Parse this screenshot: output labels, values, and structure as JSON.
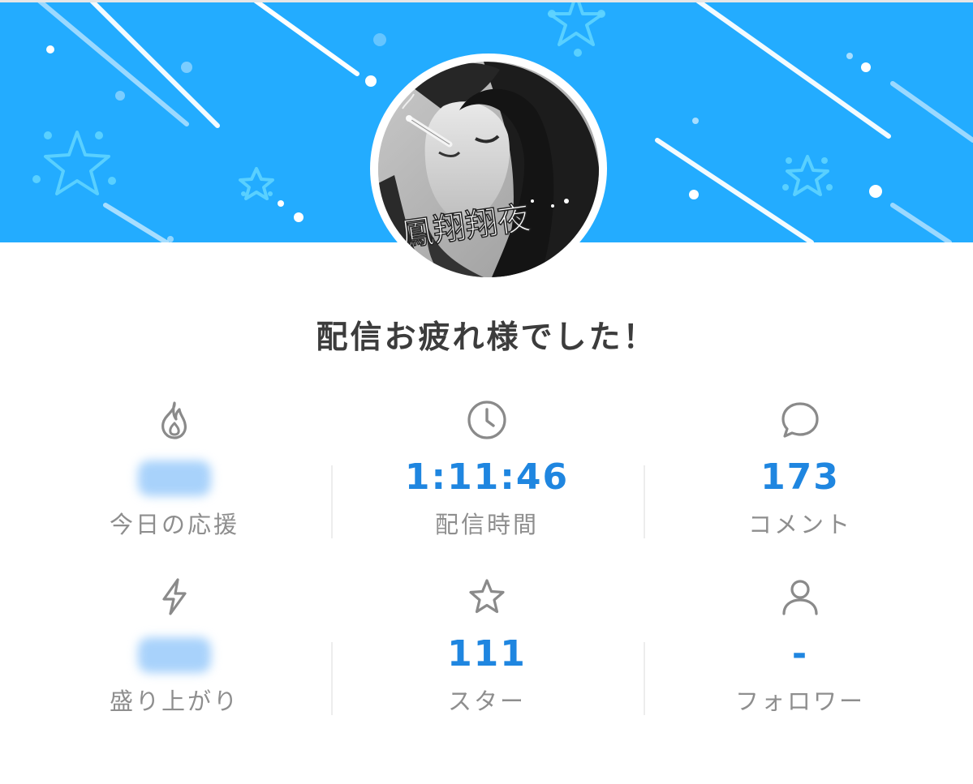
{
  "banner": {
    "color": "#23acff"
  },
  "avatar": {
    "signature_text": "鳳翔翔夜"
  },
  "title": "配信お疲れ様でした！",
  "stats": [
    {
      "icon": "flame-icon",
      "value": "",
      "label": "今日の応援",
      "value_hidden": true
    },
    {
      "icon": "clock-icon",
      "value": "1:11:46",
      "label": "配信時間"
    },
    {
      "icon": "comment-icon",
      "value": "173",
      "label": "コメント"
    },
    {
      "icon": "lightning-icon",
      "value": "",
      "label": "盛り上がり",
      "value_hidden": true
    },
    {
      "icon": "star-icon",
      "value": "111",
      "label": "スター"
    },
    {
      "icon": "person-icon",
      "value": "-",
      "label": "フォロワー"
    }
  ],
  "colors": {
    "accent": "#1f86e0",
    "label": "#8e8e8e",
    "icon": "#8a8a8a",
    "title": "#3c3c3c"
  }
}
